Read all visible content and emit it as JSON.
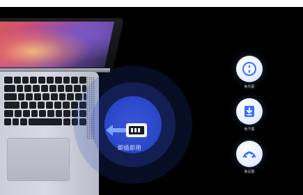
{
  "caption": "即插即用",
  "features": [
    {
      "icon": "compass-icon",
      "label": "免光驱"
    },
    {
      "icon": "download-icon",
      "label": "免下载"
    },
    {
      "icon": "install-icon",
      "label": "免设置"
    }
  ],
  "colors": {
    "background": "#000000",
    "glow": "#2a45c8",
    "accent": "#3b6cff",
    "icon_disc": "#e9efff"
  }
}
